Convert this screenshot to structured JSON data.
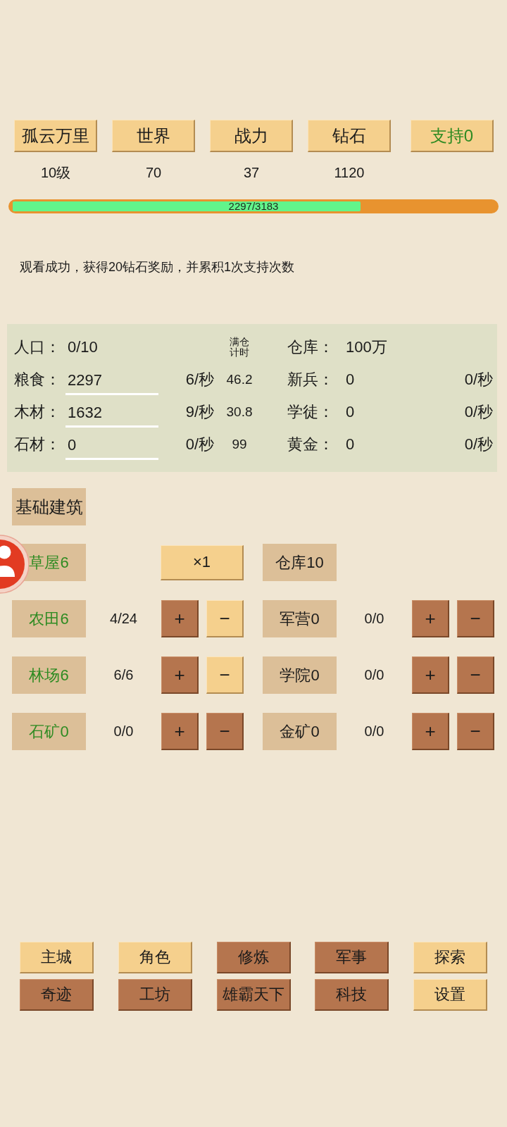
{
  "stats": [
    {
      "label": "孤云万里",
      "value": "10级",
      "accent": false
    },
    {
      "label": "世界",
      "value": "70",
      "accent": false
    },
    {
      "label": "战力",
      "value": "37",
      "accent": false
    },
    {
      "label": "钻石",
      "value": "1120",
      "accent": false
    },
    {
      "label": "支持0",
      "accent": true
    }
  ],
  "experience_bar": {
    "text": "2297/3183",
    "level": 0.7216
  },
  "message": "观看成功，获得20钻石奖励，并累积1次支持次数",
  "resources": {
    "population": {
      "label": "人口：",
      "value": "0/10"
    },
    "timer_header": "满仓计时",
    "storage": {
      "label": "仓库：",
      "value": "100万"
    },
    "rows": [
      {
        "label": "粮食：",
        "value": "2297",
        "rate": "6/秒",
        "timer": "46.2",
        "right_label": "新兵：",
        "right_value": "0",
        "right_rate": "0/秒"
      },
      {
        "label": "木材：",
        "value": "1632",
        "rate": "9/秒",
        "timer": "30.8",
        "right_label": "学徒：",
        "right_value": "0",
        "right_rate": "0/秒"
      },
      {
        "label": "石材：",
        "value": "0",
        "rate": "0/秒",
        "timer": "99",
        "right_label": "黄金：",
        "right_value": "0",
        "right_rate": "0/秒"
      }
    ]
  },
  "section_tag": "基础建筑",
  "housing": {
    "house": {
      "name": "草屋6",
      "accent": true
    },
    "multiplier": "×1",
    "warehouse": {
      "name": "仓库10",
      "accent": false
    }
  },
  "buildings": [
    [
      {
        "name": "农田6",
        "accent": true,
        "count": "4/24",
        "buttons": [
          {
            "label": "+",
            "highlighted": false
          },
          {
            "label": "−",
            "highlighted": true
          }
        ]
      },
      {
        "name": "军营0",
        "accent": false,
        "count": "0/0",
        "buttons": [
          {
            "label": "+",
            "highlighted": false
          },
          {
            "label": "−",
            "highlighted": false
          }
        ]
      }
    ],
    [
      {
        "name": "林场6",
        "accent": true,
        "count": "6/6",
        "buttons": [
          {
            "label": "+",
            "highlighted": false
          },
          {
            "label": "−",
            "highlighted": true
          }
        ]
      },
      {
        "name": "学院0",
        "accent": false,
        "count": "0/0",
        "buttons": [
          {
            "label": "+",
            "highlighted": false
          },
          {
            "label": "−",
            "highlighted": false
          }
        ]
      }
    ],
    [
      {
        "name": "石矿0",
        "accent": true,
        "count": "0/0",
        "buttons": [
          {
            "label": "+",
            "highlighted": false
          },
          {
            "label": "−",
            "highlighted": false
          }
        ]
      },
      {
        "name": "金矿0",
        "accent": false,
        "count": "0/0",
        "buttons": [
          {
            "label": "+",
            "highlighted": false
          },
          {
            "label": "−",
            "highlighted": false
          }
        ]
      }
    ]
  ],
  "nav": [
    {
      "label": "主城",
      "highlighted": true
    },
    {
      "label": "角色",
      "highlighted": true
    },
    {
      "label": "修炼",
      "highlighted": false
    },
    {
      "label": "军事",
      "highlighted": false
    },
    {
      "label": "探索",
      "highlighted": true
    },
    {
      "label": "奇迹",
      "highlighted": false
    },
    {
      "label": "工坊",
      "highlighted": false
    },
    {
      "label": "雄霸天下",
      "highlighted": false
    },
    {
      "label": "科技",
      "highlighted": false
    },
    {
      "label": "设置",
      "highlighted": true
    }
  ]
}
